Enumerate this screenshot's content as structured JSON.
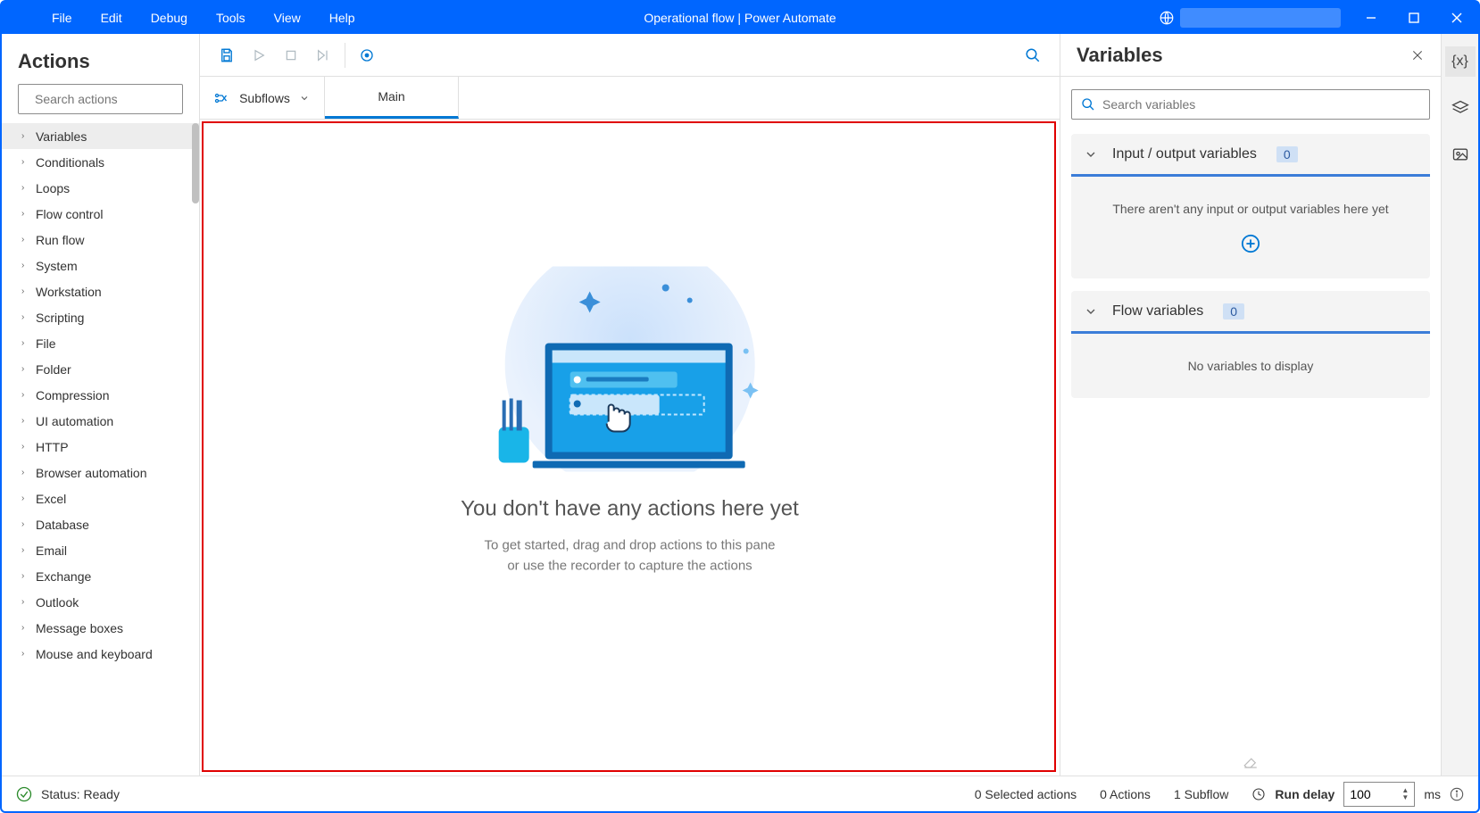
{
  "menu": {
    "file": "File",
    "edit": "Edit",
    "debug": "Debug",
    "tools": "Tools",
    "view": "View",
    "help": "Help"
  },
  "title": "Operational flow | Power Automate",
  "actions": {
    "title": "Actions",
    "search_placeholder": "Search actions",
    "items": [
      "Variables",
      "Conditionals",
      "Loops",
      "Flow control",
      "Run flow",
      "System",
      "Workstation",
      "Scripting",
      "File",
      "Folder",
      "Compression",
      "UI automation",
      "HTTP",
      "Browser automation",
      "Excel",
      "Database",
      "Email",
      "Exchange",
      "Outlook",
      "Message boxes",
      "Mouse and keyboard"
    ]
  },
  "tabs": {
    "subflows": "Subflows",
    "main": "Main"
  },
  "empty": {
    "heading": "You don't have any actions here yet",
    "line1": "To get started, drag and drop actions to this pane",
    "line2": "or use the recorder to capture the actions"
  },
  "variables": {
    "title": "Variables",
    "search_placeholder": "Search variables",
    "io_title": "Input / output variables",
    "io_count": "0",
    "io_empty": "There aren't any input or output variables here yet",
    "flow_title": "Flow variables",
    "flow_count": "0",
    "flow_empty": "No variables to display"
  },
  "status": {
    "ready": "Status: Ready",
    "selected": "0 Selected actions",
    "actions": "0 Actions",
    "subflow": "1 Subflow",
    "delay_label": "Run delay",
    "delay_value": "100",
    "ms": "ms"
  }
}
